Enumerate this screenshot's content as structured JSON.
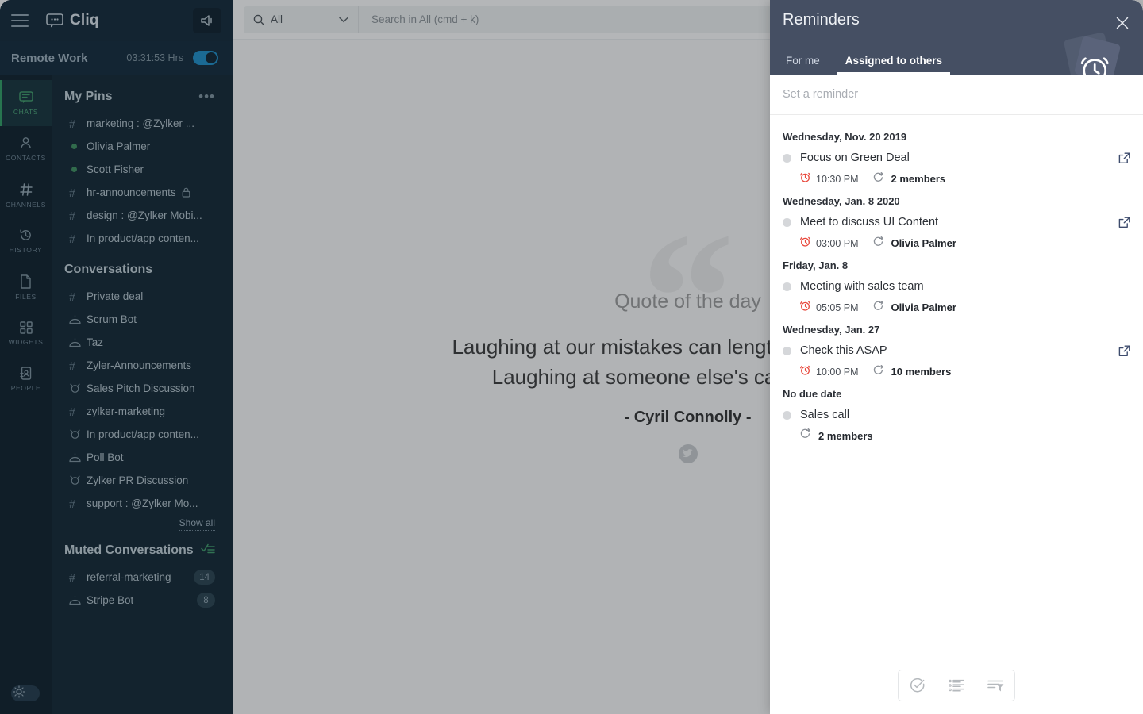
{
  "app": {
    "brand": "Cliq",
    "menu_icon": "hamburger-icon",
    "logo_icon": "chat-bubble-icon",
    "announce_icon": "megaphone-icon"
  },
  "status": {
    "title": "Remote Work",
    "time": "03:31:53 Hrs",
    "toggle_on": true
  },
  "rail": [
    {
      "label": "CHATS",
      "icon": "chat-icon",
      "active": true
    },
    {
      "label": "CONTACTS",
      "icon": "person-icon",
      "active": false
    },
    {
      "label": "CHANNELS",
      "icon": "hash-icon",
      "active": false
    },
    {
      "label": "HISTORY",
      "icon": "history-icon",
      "active": false
    },
    {
      "label": "FILES",
      "icon": "file-icon",
      "active": false
    },
    {
      "label": "WIDGETS",
      "icon": "grid-icon",
      "active": false
    },
    {
      "label": "PEOPLE",
      "icon": "contact-card-icon",
      "active": false
    }
  ],
  "pins": {
    "title": "My Pins",
    "more_icon": "ellipsis-icon",
    "items": [
      {
        "label": "marketing : @Zylker ...",
        "icon": "hash-icon",
        "locked": false
      },
      {
        "label": "Olivia Palmer",
        "icon": "status-dot-online",
        "locked": false
      },
      {
        "label": "Scott Fisher",
        "icon": "status-dot-online",
        "locked": false
      },
      {
        "label": "hr-announcements",
        "icon": "hash-icon",
        "locked": true
      },
      {
        "label": "design : @Zylker Mobi...",
        "icon": "hash-icon",
        "locked": false
      },
      {
        "label": "In product/app conten...",
        "icon": "hash-icon",
        "locked": false
      }
    ]
  },
  "conversations": {
    "title": "Conversations",
    "show_all": "Show all",
    "items": [
      {
        "label": "Private deal",
        "icon": "hash-icon"
      },
      {
        "label": "Scrum Bot",
        "icon": "bot-icon"
      },
      {
        "label": "Taz",
        "icon": "bot-icon"
      },
      {
        "label": "Zyler-Announcements",
        "icon": "hash-icon"
      },
      {
        "label": "Sales Pitch Discussion",
        "icon": "group-chat-icon"
      },
      {
        "label": "zylker-marketing",
        "icon": "hash-icon"
      },
      {
        "label": "In product/app conten...",
        "icon": "group-chat-icon"
      },
      {
        "label": "Poll Bot",
        "icon": "bot-icon"
      },
      {
        "label": "Zylker PR Discussion",
        "icon": "group-chat-icon"
      },
      {
        "label": "support : @Zylker Mo...",
        "icon": "hash-icon"
      }
    ]
  },
  "muted": {
    "title": "Muted Conversations",
    "action_icon": "mark-read-icon",
    "items": [
      {
        "label": "referral-marketing",
        "icon": "hash-icon",
        "badge": "14"
      },
      {
        "label": "Stripe Bot",
        "icon": "bot-icon",
        "badge": "8"
      }
    ]
  },
  "theme_toggle_icon": "sun-icon",
  "topbar": {
    "scope_label": "All",
    "scope_icon": "search-icon",
    "scope_caret": "chevron-down-icon",
    "search_placeholder": "Search in All (cmd + k)",
    "search_value": "",
    "add_label": "+"
  },
  "quote": {
    "kicker": "Quote of the day",
    "text": "Laughing at our mistakes can lengthen our own life.\nLaughing at someone else's can shorten it.",
    "author": "- Cyril Connolly -",
    "share_icon": "twitter-icon",
    "decor": "“"
  },
  "panel": {
    "title": "Reminders",
    "close_icon": "close-icon",
    "watermark_icon": "alarm-clock-icon",
    "tabs": [
      {
        "label": "For me",
        "active": false
      },
      {
        "label": "Assigned to others",
        "active": true
      }
    ],
    "input_placeholder": "Set a reminder",
    "groups": [
      {
        "date": "Wednesday, Nov. 20 2019",
        "items": [
          {
            "title": "Focus on Green Deal",
            "time": "10:30 PM",
            "assignee": "2 members",
            "has_link": true
          }
        ]
      },
      {
        "date": "Wednesday, Jan. 8 2020",
        "items": [
          {
            "title": "Meet to discuss UI Content",
            "time": "03:00 PM",
            "assignee": "Olivia Palmer",
            "has_link": true
          }
        ]
      },
      {
        "date": "Friday, Jan. 8",
        "items": [
          {
            "title": "Meeting with sales team",
            "time": "05:05 PM",
            "assignee": "Olivia Palmer",
            "has_link": false
          }
        ]
      },
      {
        "date": "Wednesday, Jan. 27",
        "items": [
          {
            "title": "Check this ASAP",
            "time": "10:00 PM",
            "assignee": "10 members",
            "has_link": true
          }
        ]
      },
      {
        "date": "No due date",
        "items": [
          {
            "title": "Sales call",
            "time": "",
            "assignee": "2 members",
            "has_link": false
          }
        ]
      }
    ],
    "footer": [
      {
        "icon": "check-circle-icon",
        "name": "completed-reminders-button"
      },
      {
        "icon": "list-icon",
        "name": "list-view-button"
      },
      {
        "icon": "filter-icon",
        "name": "filter-button"
      }
    ],
    "colors": {
      "header_bg": "#454f63",
      "alarm_red": "#e8483c",
      "link_blue": "#3e4c6d"
    }
  }
}
